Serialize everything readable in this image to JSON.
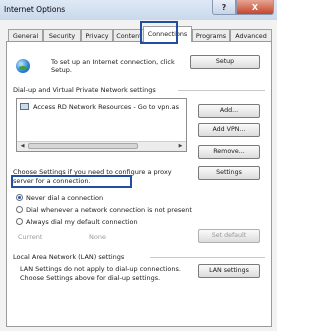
{
  "window": {
    "title": "Internet Options",
    "help_glyph": "?",
    "close_glyph": "X"
  },
  "tabs": [
    "General",
    "Security",
    "Privacy",
    "Content",
    "Connections",
    "Programs",
    "Advanced"
  ],
  "setup": {
    "text_line1": "To set up an Internet connection, click",
    "text_line2": "Setup.",
    "button": "Setup"
  },
  "dialup": {
    "heading": "Dial-up and Virtual Private Network settings",
    "list_item": "Access RD Network Resources - Go to vpn.as",
    "add_button": "Add...",
    "add_vpn_button": "Add VPN...",
    "remove_button": "Remove...",
    "proxy_text_line1": "Choose Settings if you need to configure a proxy",
    "proxy_text_line2": "server for a connection.",
    "settings_button": "Settings"
  },
  "radios": {
    "never": "Never dial a connection",
    "whenever": "Dial whenever a network connection is not present",
    "always": "Always dial my default connection",
    "selected": "never"
  },
  "current": {
    "label": "Current",
    "value": "None",
    "set_default_button": "Set default"
  },
  "lan": {
    "heading": "Local Area Network (LAN) settings",
    "text_line1": "LAN Settings do not apply to dial-up connections.",
    "text_line2": "Choose Settings above for dial-up settings.",
    "button": "LAN settings"
  },
  "colors": {
    "highlight": "#1f4ea3",
    "title_gradient_top": "#dfe9f5",
    "close_button": "#c4462c"
  }
}
